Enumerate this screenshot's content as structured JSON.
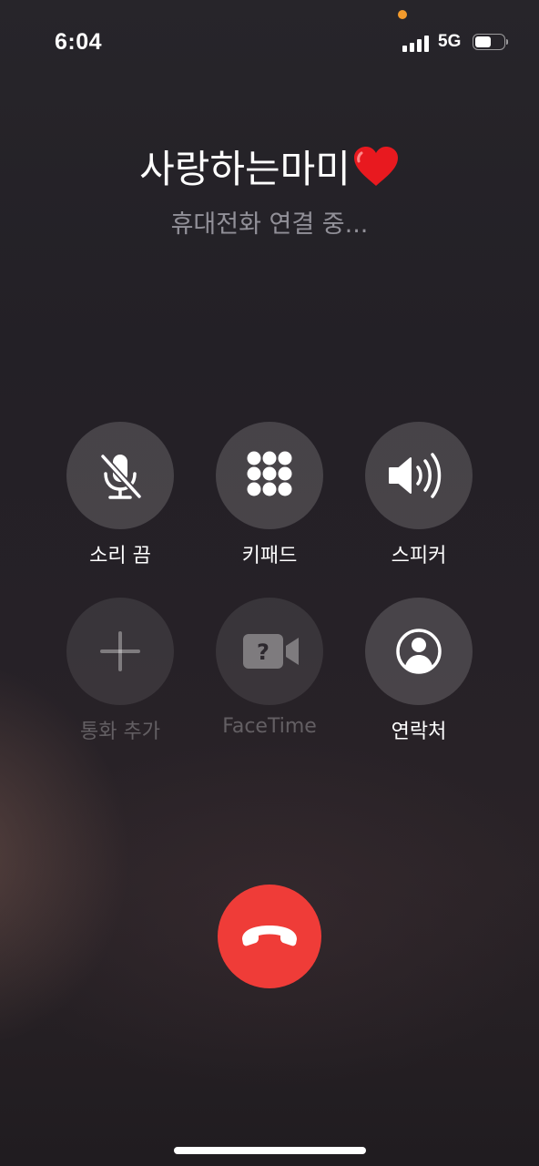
{
  "status_bar": {
    "time": "6:04",
    "network": "5G",
    "signal_bars": 4,
    "battery_level": 0.55,
    "privacy_indicator_color": "#f39b2c"
  },
  "call": {
    "caller_name": "사랑하는마미",
    "caller_emoji": "red-heart",
    "status": "휴대전화 연결 중..."
  },
  "controls": {
    "mute": {
      "label": "소리 끔",
      "icon": "microphone-slash-icon",
      "enabled": true
    },
    "keypad": {
      "label": "키패드",
      "icon": "keypad-grid-icon",
      "enabled": true
    },
    "speaker": {
      "label": "스피커",
      "icon": "speaker-wave-icon",
      "enabled": true
    },
    "add_call": {
      "label": "통화 추가",
      "icon": "plus-icon",
      "enabled": false
    },
    "facetime": {
      "label": "FaceTime",
      "icon": "facetime-unknown-icon",
      "enabled": false
    },
    "contacts": {
      "label": "연락처",
      "icon": "person-circle-icon",
      "enabled": true
    }
  },
  "end_call": {
    "icon": "phone-hangup-icon",
    "color": "#ef3c38"
  },
  "colors": {
    "background": "#232026",
    "button_fill": "rgba(255,255,255,0.16)",
    "status_text": "rgba(235,235,245,0.55)"
  }
}
